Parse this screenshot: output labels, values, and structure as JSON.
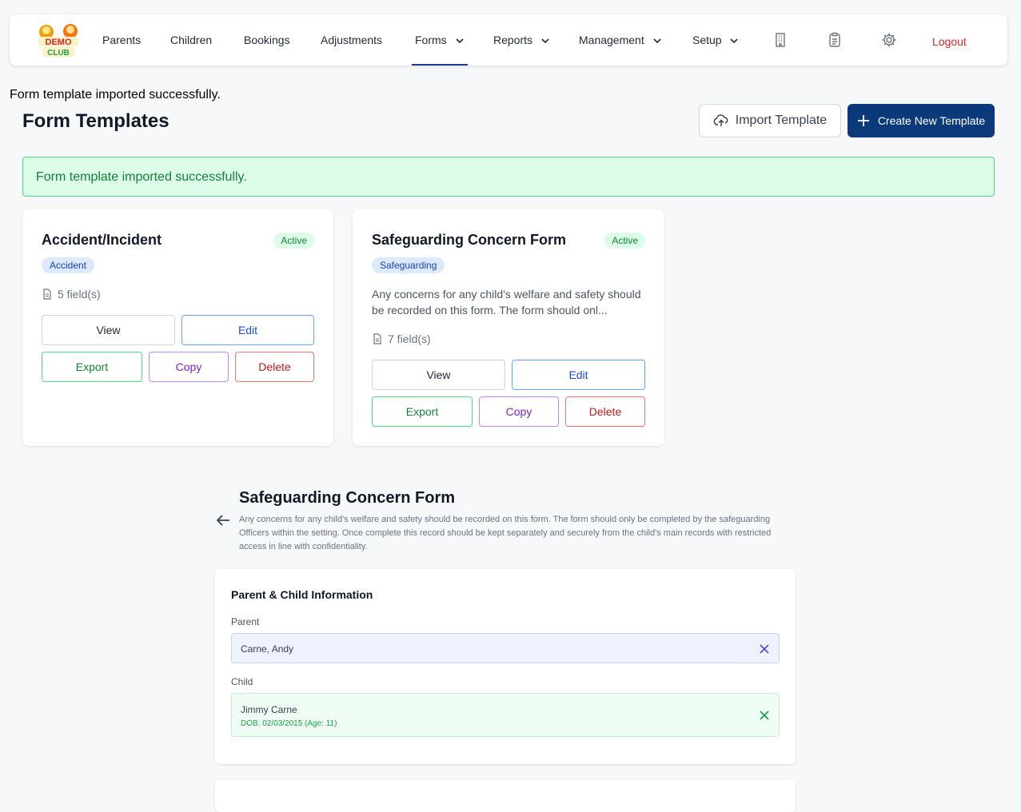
{
  "nav": {
    "logo_text": "DEMO CLUB",
    "items": [
      {
        "label": "Parents"
      },
      {
        "label": "Children"
      },
      {
        "label": "Bookings"
      },
      {
        "label": "Adjustments"
      },
      {
        "label": "Forms"
      },
      {
        "label": "Reports"
      },
      {
        "label": "Management"
      },
      {
        "label": "Setup"
      }
    ],
    "icons": [
      "building-icon",
      "clipboard-icon",
      "gear-icon"
    ],
    "logout": "Logout",
    "active": "Forms"
  },
  "top_message": "Form template imported successfully.",
  "page_title": "Form Templates",
  "buttons": {
    "import": "Import Template",
    "create": "Create New Template"
  },
  "alert": "Form template imported successfully.",
  "templates": [
    {
      "title": "Accident/Incident",
      "status": "Active",
      "category": "Accident",
      "description": "",
      "fields": "5 field(s)",
      "actions": {
        "view": "View",
        "edit": "Edit",
        "export": "Export",
        "copy": "Copy",
        "delete": "Delete"
      }
    },
    {
      "title": "Safeguarding Concern Form",
      "status": "Active",
      "category": "Safeguarding",
      "description": "Any concerns for any child's welfare and safety should be recorded on this form. The form should onl...",
      "fields": "7 field(s)",
      "actions": {
        "view": "View",
        "edit": "Edit",
        "export": "Export",
        "copy": "Copy",
        "delete": "Delete"
      }
    }
  ],
  "preview": {
    "title": "Safeguarding Concern Form",
    "description": "Any concerns for any child's welfare and safety should be recorded on this form. The form should only be completed by the safeguarding Officers within the setting. Once complete this record should be kept separately and securely from the child's main records with restricted access in line with confidentiality.",
    "section_title": "Parent & Child Information",
    "parent_label": "Parent",
    "parent_value": "Carne, Andy",
    "child_label": "Child",
    "child_name": "Jimmy Carne",
    "child_dob": "DOB: 02/03/2015 (Age: 11)"
  },
  "colors": {
    "primary": "#0b3a7a",
    "success": "#15803d",
    "danger": "#dc2626",
    "purple": "#7e22ce",
    "blue": "#1d4ed8"
  }
}
